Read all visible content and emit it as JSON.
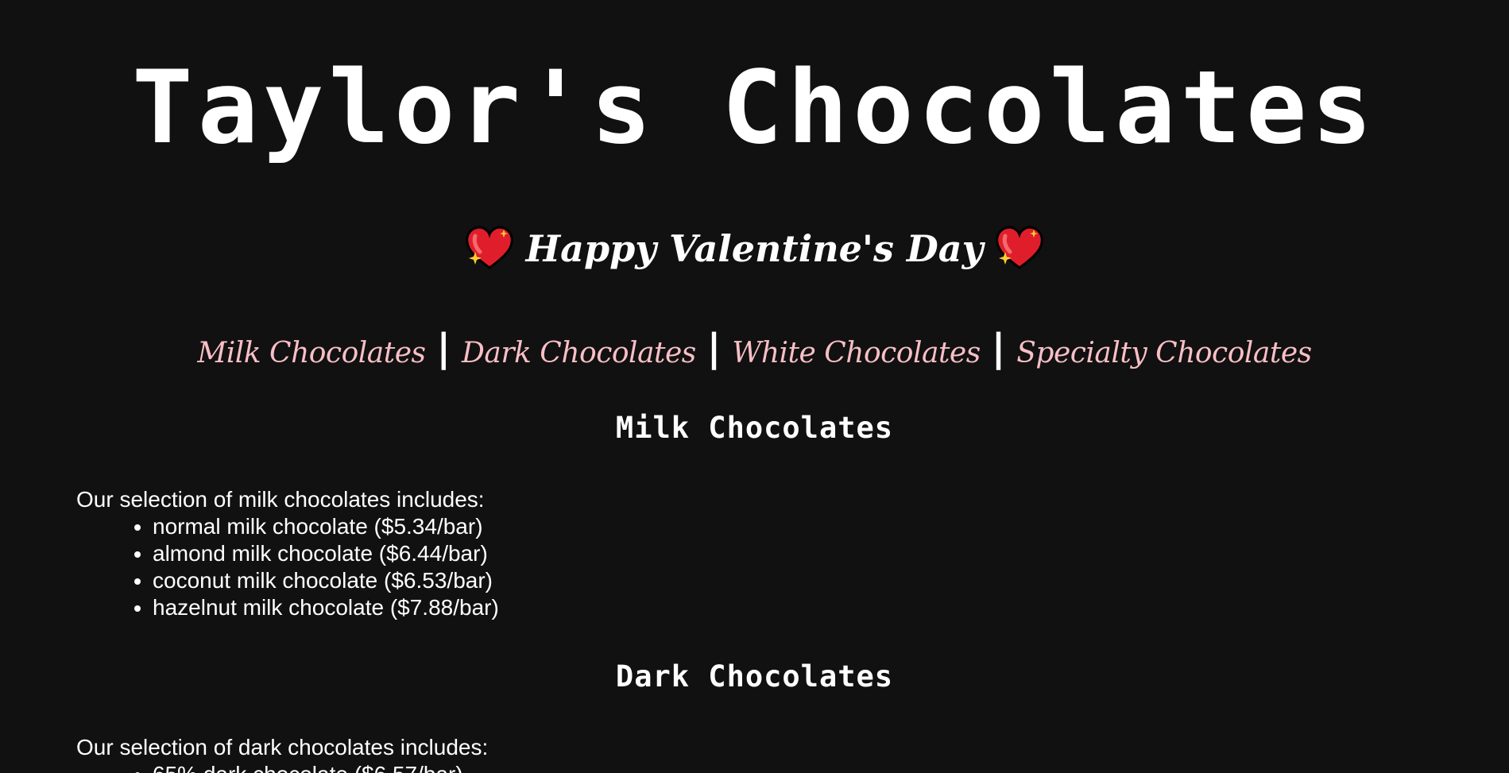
{
  "header": {
    "title": "Taylor's Chocolates",
    "subtitle": "Happy Valentine's Day",
    "heart_icon": "sparkling-heart-icon"
  },
  "nav": {
    "links": [
      {
        "label": "Milk Chocolates"
      },
      {
        "label": "Dark Chocolates"
      },
      {
        "label": "White Chocolates"
      },
      {
        "label": "Specialty Chocolates"
      }
    ],
    "separator": "|"
  },
  "sections": [
    {
      "heading": "Milk Chocolates",
      "intro": "Our selection of milk chocolates includes:",
      "items": [
        "normal milk chocolate ($5.34/bar)",
        "almond milk chocolate ($6.44/bar)",
        "coconut milk chocolate ($6.53/bar)",
        "hazelnut milk chocolate ($7.88/bar)"
      ]
    },
    {
      "heading": "Dark Chocolates",
      "intro": "Our selection of dark chocolates includes:",
      "items": [
        "65% dark chocolate ($6.57/bar)"
      ]
    }
  ],
  "colors": {
    "background": "#111111",
    "text": "#ffffff",
    "link": "#f9bfc6"
  }
}
